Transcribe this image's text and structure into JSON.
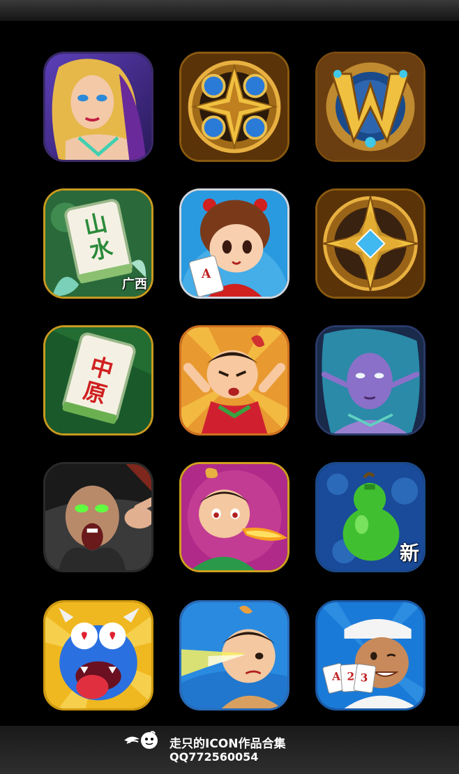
{
  "gallery": {
    "tiles": [
      {
        "id": "sorceress",
        "icon": "fantasy-sorceress-icon"
      },
      {
        "id": "golden-compass",
        "icon": "golden-compass-emblem-icon"
      },
      {
        "id": "w-crest",
        "icon": "golden-w-crest-icon"
      },
      {
        "id": "mahjong-guangxi",
        "icon": "mahjong-shanshui-tile-icon",
        "tile_text": "山水",
        "badge": "广西"
      },
      {
        "id": "card-girl",
        "icon": "cartoon-girl-with-card-icon",
        "card_text": "A"
      },
      {
        "id": "star-compass",
        "icon": "star-compass-emblem-icon"
      },
      {
        "id": "mahjong-zhongyuan",
        "icon": "mahjong-zhongyuan-tile-icon",
        "tile_text": "中原"
      },
      {
        "id": "calabash-boy-red",
        "icon": "calabash-brother-icon"
      },
      {
        "id": "night-elf",
        "icon": "night-elf-woman-icon"
      },
      {
        "id": "warlord",
        "icon": "shouting-warlord-icon"
      },
      {
        "id": "calabash-boy-fire",
        "icon": "fire-breathing-calabash-brother-icon"
      },
      {
        "id": "green-gourd",
        "icon": "green-gourd-icon",
        "badge": "新"
      },
      {
        "id": "blue-monster",
        "icon": "blue-monster-icon"
      },
      {
        "id": "calabash-boy-beam",
        "icon": "eye-beam-calabash-brother-icon"
      },
      {
        "id": "card-man",
        "icon": "card-playing-man-icon",
        "cards": [
          "A",
          "2",
          "3"
        ]
      }
    ]
  },
  "footer": {
    "logo_icon": "winged-face-logo-icon",
    "title": "走只的ICON作品合集",
    "qq": "QQ772560054"
  }
}
